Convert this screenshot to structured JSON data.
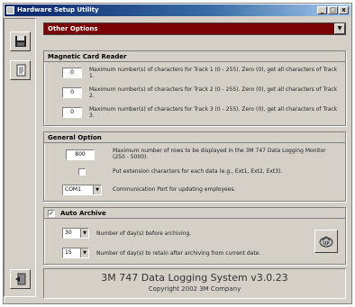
{
  "window": {
    "title": "Hardware Setup Utility"
  },
  "title_buttons": {
    "minimize": "_",
    "maximize": "□",
    "close": "x"
  },
  "options_combo": {
    "value": "Other Options"
  },
  "magnetic": {
    "title": "Magnetic Card Reader",
    "rows": [
      {
        "value": "0",
        "text": "Maximum number(s) of characters for Track 1 (0 - 255). Zero (0), get all characters of Track 1."
      },
      {
        "value": "0",
        "text": "Maximum number(s) of characters for Track 2 (0 - 255). Zero (0), get all characters of Track 2."
      },
      {
        "value": "0",
        "text": "Maximum number(s) of characters for Track 3 (0 - 255). Zero (0), get all characters of Track 3."
      }
    ]
  },
  "general": {
    "title": "General Option",
    "max_rows_value": "800",
    "max_rows_text": "Maximum number of rows to be displayed in the 3M 747 Data Logging Monitor (250 - 5000).",
    "ext_text": "Put extension characters for each data (e.g., Ext1, Ext2, Ext3).",
    "comm_value": "COM1",
    "comm_text": "Communication Port for updating employees."
  },
  "archive": {
    "title": "Auto Archive",
    "checked": "✓",
    "days_before_value": "30",
    "days_before_text": "Number of day(s) before archiving.",
    "days_retain_value": "15",
    "days_retain_text": "Number of day(s) to retain after archiving from current date."
  },
  "footer": {
    "version": "3M 747 Data Logging System v3.0.23",
    "copyright": "Copyright 2002 3M Company"
  }
}
